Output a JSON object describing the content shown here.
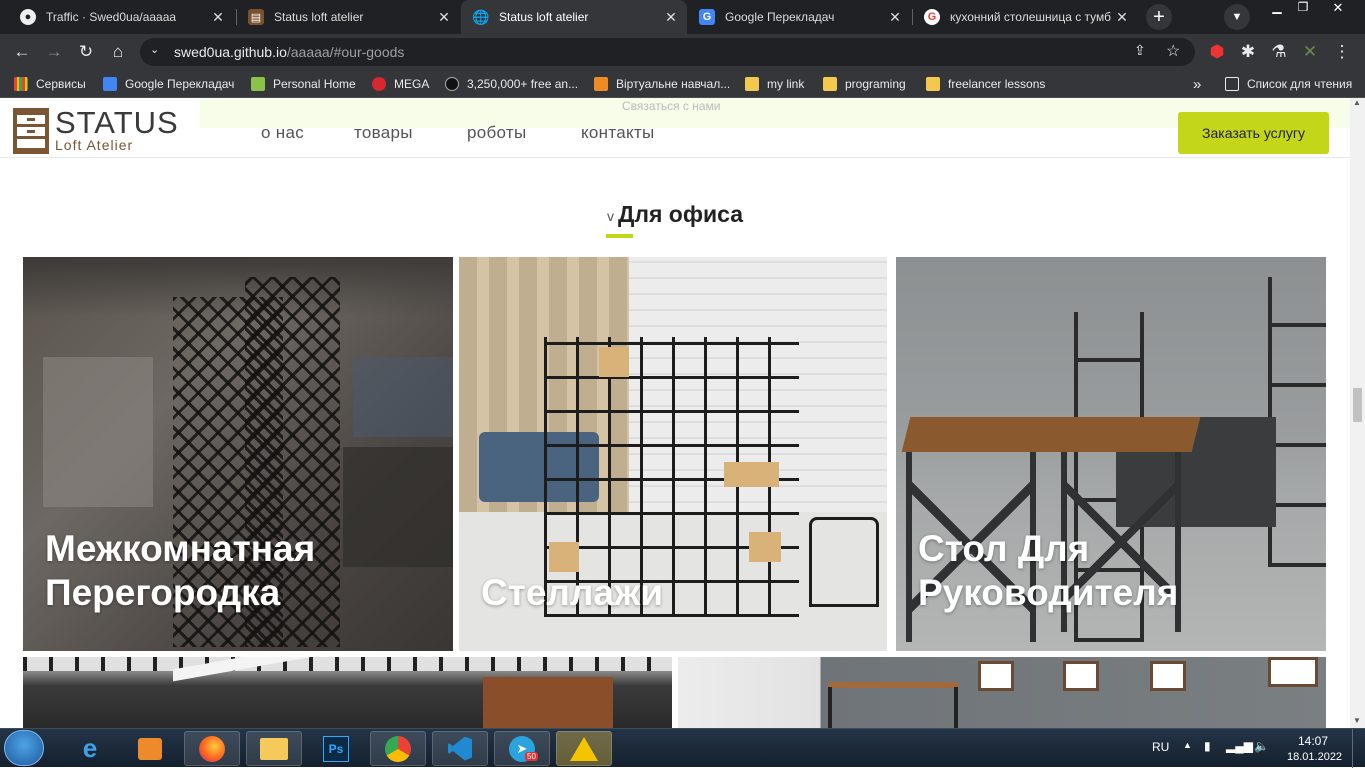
{
  "browser": {
    "tabs": [
      {
        "title": "Traffic · Swed0ua/aaaaa",
        "active": false,
        "icon": "github-icon"
      },
      {
        "title": "Status loft atelier",
        "active": false,
        "icon": "site-icon"
      },
      {
        "title": "Status loft atelier",
        "active": true,
        "icon": "globe-icon"
      },
      {
        "title": "Google Перекладач",
        "active": false,
        "icon": "translate-icon"
      },
      {
        "title": "кухонний столешница с тумб",
        "active": false,
        "icon": "google-icon"
      }
    ],
    "url_host": "swed0ua.github.io",
    "url_path": "/aaaaa/#our-goods",
    "bookmarks": [
      "Сервисы",
      "Google Перекладач",
      "Personal Home",
      "MEGA",
      "3,250,000+ free an...",
      "Віртуальне навчал...",
      "my link",
      "programing",
      "freelancer lessons"
    ],
    "reading_list": "Список для чтения",
    "more_bookmarks": "»"
  },
  "site": {
    "topbar_text": "Связаться с нами",
    "logo_title": "STATUS",
    "logo_subtitle": "Loft Atelier",
    "nav": [
      "о нас",
      "товары",
      "роботы",
      "контакты"
    ],
    "cta": "Заказать услугу",
    "section_chevron": "v",
    "section_title": "Для офиса",
    "products": [
      {
        "line1": "Межкомнатная",
        "line2": "Перегородка"
      },
      {
        "line1": "",
        "line2": "Стеллажи"
      },
      {
        "line1": "Стол Для",
        "line2": "Руководителя"
      }
    ]
  },
  "taskbar": {
    "lang": "RU",
    "time": "14:07",
    "date": "18.01.2022",
    "telegram_badge": "50"
  },
  "colors": {
    "accent": "#c4d61a",
    "browser_dark": "#202124",
    "browser_toolbar": "#35363a"
  }
}
